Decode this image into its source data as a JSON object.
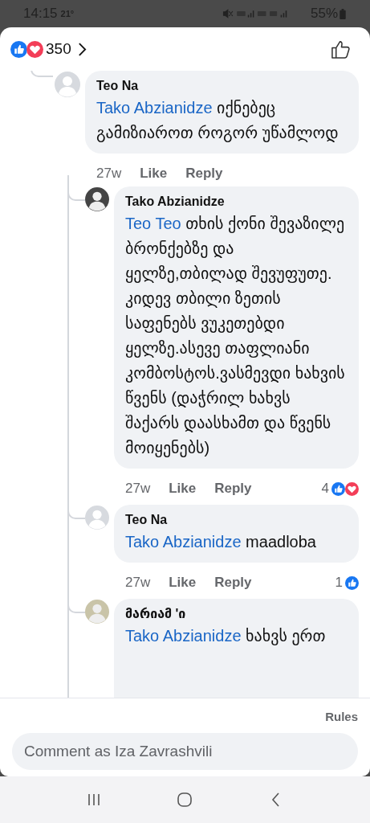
{
  "status_bar": {
    "time": "14:15",
    "temperature": "21°",
    "battery": "55%"
  },
  "header": {
    "reactions": [
      {
        "kind": "like"
      },
      {
        "kind": "love"
      }
    ],
    "count": "350"
  },
  "comments": [
    {
      "author": "Teo Na",
      "avatar": {
        "kind": "placeholder"
      },
      "mention": "Tako Abzianidze",
      "text": "იქნებეც გამიზიაროთ როგორ უწამლოდ",
      "time": "27w",
      "like": "Like",
      "reply": "Reply",
      "children": [
        {
          "author": "Tako Abzianidze",
          "avatar": {
            "kind": "photo"
          },
          "mention": "Teo Teo",
          "text": "თხის ქონი შევაზილე ბრონქებზე და ყელზე,თბილად შევუფუთე. კიდევ თბილი ზეთის საფენებს ვუკეთებდი ყელზე.ასევე თაფლიანი კომბოსტოს.ვასმევდი ხახვის წვენს (დაჭრილ ხახვს შაქარს დაასხამთ და წვენს მოიყენებს)",
          "time": "27w",
          "like": "Like",
          "reply": "Reply",
          "reactions": {
            "count": "4",
            "icons": [
              {
                "kind": "like"
              },
              {
                "kind": "love"
              }
            ]
          }
        },
        {
          "author": "Teo Na",
          "avatar": {
            "kind": "placeholder"
          },
          "mention": "Tako Abzianidze",
          "text": "maadloba",
          "time": "27w",
          "like": "Like",
          "reply": "Reply",
          "reactions": {
            "count": "1",
            "icons": [
              {
                "kind": "like"
              }
            ]
          }
        },
        {
          "author": "მარიამ 'ი",
          "avatar": {
            "kind": "photo"
          },
          "mention": "Tako Abzianidze",
          "text": "ხახვს ერთ"
        }
      ]
    }
  ],
  "footer": {
    "rules": "Rules",
    "placeholder": "Comment as Iza Zavrashvili"
  }
}
